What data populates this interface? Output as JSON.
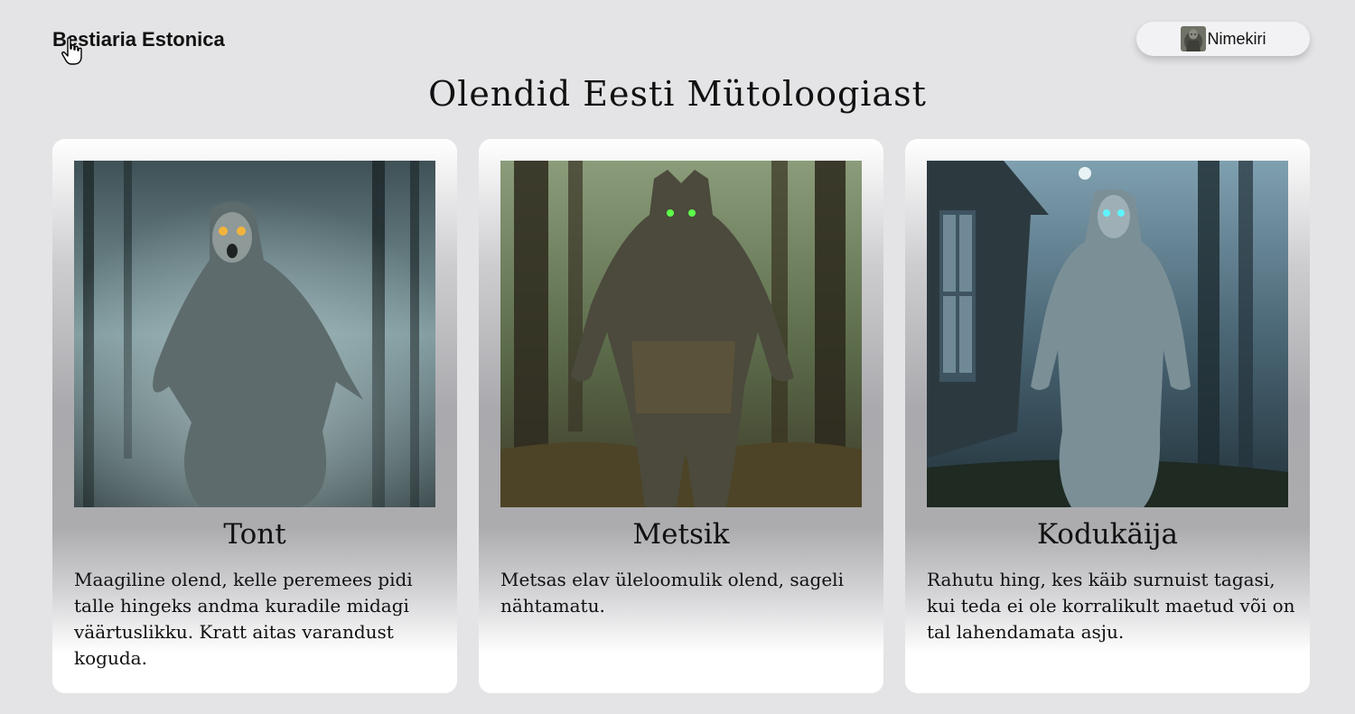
{
  "header": {
    "brand": "Bestiaria Estonica",
    "nav_button_label": "Nimekiri",
    "nav_button_icon": "creature-avatar-icon"
  },
  "main": {
    "title": "Olendid Eesti Mütoloogiast",
    "cards": [
      {
        "name": "Tont",
        "description": "Maagiline olend, kelle peremees pidi talle hingeks andma kuradile midagi väärtuslikku. Kratt aitas varandust koguda.",
        "image": "tont-illustration"
      },
      {
        "name": "Metsik",
        "description": "Metsas elav üleloomulik olend, sageli nähtamatu.",
        "image": "metsik-illustration"
      },
      {
        "name": "Kodukäija",
        "description": "Rahutu hing, kes käib surnuist tagasi, kui teda ei ole korralikult maetud või on tal lahendamata asju.",
        "image": "kodukaija-illustration"
      }
    ]
  },
  "colors": {
    "background": "#e4e4e6",
    "card": "#ffffff",
    "text": "#111111"
  }
}
